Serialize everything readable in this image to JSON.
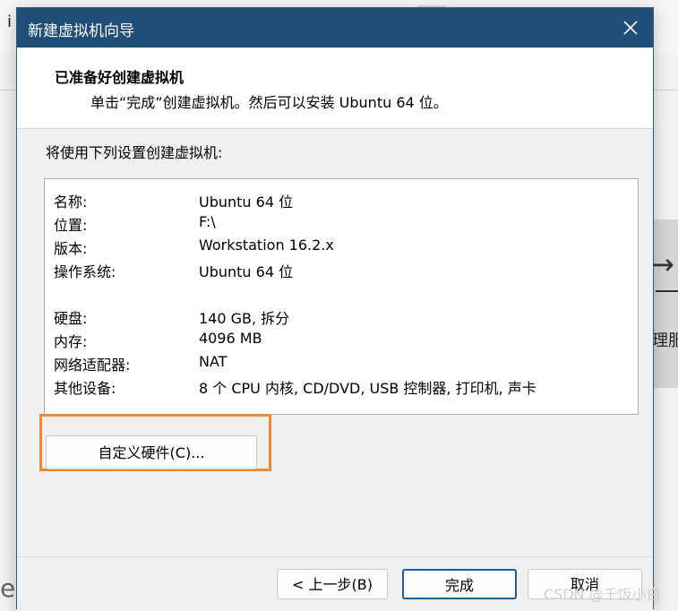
{
  "background": {
    "top_char": "i",
    "right_arrow": "→",
    "right_text": "理服",
    "left_char": "e",
    "watermark": "CSDN @千饭小白"
  },
  "dialog": {
    "title": "新建虚拟机向导",
    "header_title": "已准备好创建虚拟机",
    "header_subtitle": "单击“完成”创建虚拟机。然后可以安装 Ubuntu 64 位。",
    "intro": "将使用下列设置创建虚拟机:",
    "settings": [
      {
        "key": "名称:",
        "value": "Ubuntu 64 位"
      },
      {
        "key": "位置:",
        "value": "F:\\"
      },
      {
        "key": "版本:",
        "value": "Workstation 16.2.x"
      },
      {
        "key": "操作系统:",
        "value": "Ubuntu 64 位"
      },
      {
        "key": "硬盘:",
        "value": "140 GB, 拆分"
      },
      {
        "key": "内存:",
        "value": "4096 MB"
      },
      {
        "key": "网络适配器:",
        "value": "NAT"
      },
      {
        "key": "其他设备:",
        "value": "8 个 CPU 内核, CD/DVD, USB 控制器, 打印机, 声卡"
      }
    ],
    "customize_button": "自定义硬件(C)...",
    "back_button": "< 上一步(B)",
    "finish_button": "完成",
    "cancel_button": "取消"
  },
  "colors": {
    "titlebar": "#1f4e79",
    "highlight": "#f08a30"
  }
}
